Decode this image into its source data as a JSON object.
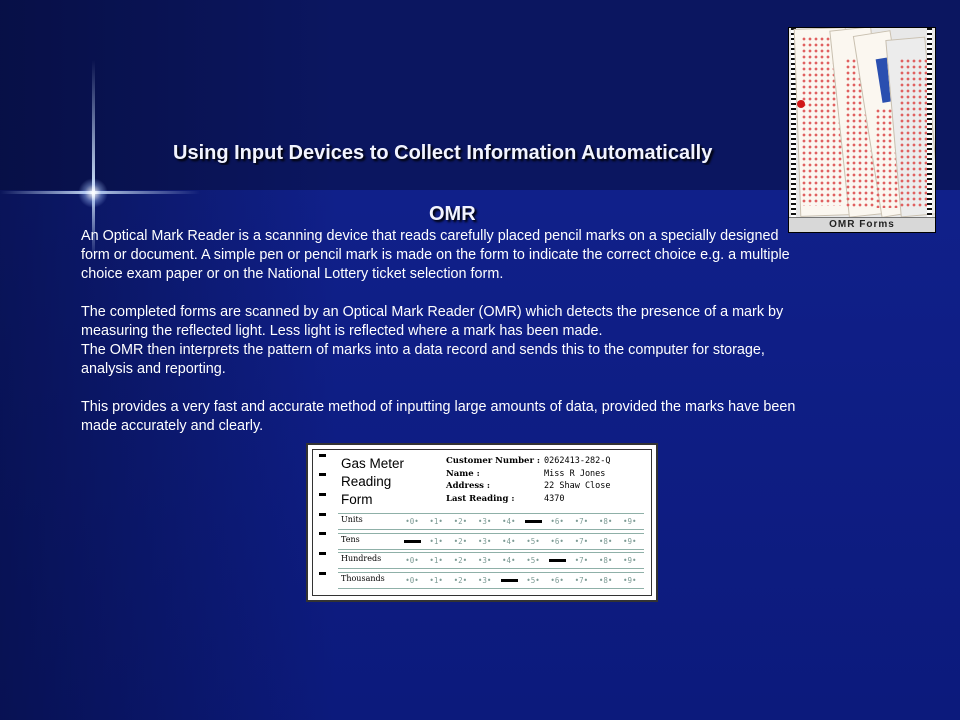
{
  "slide": {
    "title": "Using Input Devices to Collect Information Automatically",
    "subtitle": "OMR",
    "paragraphs": [
      "An Optical Mark Reader is a scanning device that reads carefully  placed pencil marks on a specially designed form or document. A simple pen or pencil mark is made on the form to indicate the correct choice e.g. a multiple choice exam paper or on the National Lottery ticket selection form.",
      "The completed forms are scanned by an Optical Mark Reader (OMR) which detects the presence of a mark by measuring the reflected light.  Less light is reflected where a mark has been made.",
      "The OMR then interprets the pattern of marks into a data record and sends this to the computer for storage, analysis and reporting.",
      "This provides a very fast and accurate method of inputting large amounts of data, provided the marks have been made accurately and clearly."
    ]
  },
  "photo": {
    "caption": "OMR Forms"
  },
  "gas_form": {
    "title_lines": [
      "Gas Meter",
      "Reading",
      "Form"
    ],
    "customer": [
      {
        "label": "Customer Number :",
        "value": "0262413-282-Q"
      },
      {
        "label": "Name :",
        "value": "Miss R Jones"
      },
      {
        "label": "Address :",
        "value": "22 Shaw Close"
      },
      {
        "label": "Last Reading :",
        "value": "4370"
      }
    ],
    "digits": [
      "0",
      "1",
      "2",
      "3",
      "4",
      "5",
      "6",
      "7",
      "8",
      "9"
    ],
    "rows": [
      {
        "label": "Units",
        "marked": 5
      },
      {
        "label": "Tens",
        "marked": 0
      },
      {
        "label": "Hundreds",
        "marked": 6
      },
      {
        "label": "Thousands",
        "marked": 4
      }
    ]
  }
}
